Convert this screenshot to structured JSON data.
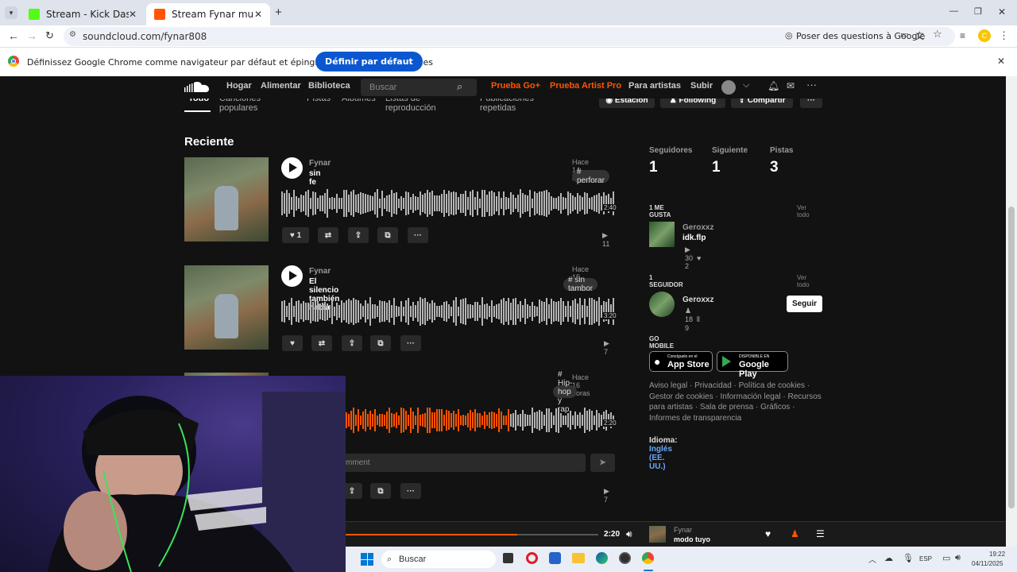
{
  "browser": {
    "tabs": [
      {
        "label": "Stream - Kick Dashboard"
      },
      {
        "label": "Stream Fynar music | Listen to s"
      }
    ],
    "url": "soundcloud.com/fynar808",
    "ask_google": "Poser des questions à Google",
    "infobar_text": "Définissez Google Chrome comme navigateur par défaut et épinglez-le à la barre des tâches",
    "infobar_button": "Définir par défaut"
  },
  "nav": {
    "links": [
      "Hogar",
      "Alimentar",
      "Biblioteca"
    ],
    "search_placeholder": "Buscar",
    "go_plus": "Prueba Go+",
    "artist_pro": "Prueba Artist Pro",
    "for_artists": "Para artistas",
    "upload": "Subir"
  },
  "profile_tabs": [
    "Todo",
    "Canciones populares",
    "Pistas",
    "Álbumes",
    "Listas de reproducción",
    "Publicaciones repetidas"
  ],
  "profile_actions": {
    "station": "Estación",
    "following": "Following",
    "share": "Compartir"
  },
  "section_title": "Reciente",
  "tracks": [
    {
      "artist": "Fynar",
      "title": "sin fe",
      "time": "Hace 14 horas",
      "tag": "# perforar",
      "likes": "1",
      "duration": "2:40",
      "plays": "11"
    },
    {
      "artist": "Fynar",
      "title": "El silencio también habla",
      "time": "Hace 15 horas",
      "tag": "# sin tambor",
      "likes": "",
      "duration": "3:20",
      "plays": "7"
    },
    {
      "artist": "Fynar",
      "title": "",
      "time": "Hace 16 horas",
      "tag": "# Hip-hop y rap",
      "likes": "",
      "duration": "2:20",
      "plays": "7",
      "comment_placeholder": "mment",
      "progress": 0.68
    }
  ],
  "stats": [
    {
      "label": "Seguidores",
      "value": "1"
    },
    {
      "label": "Siguiente",
      "value": "1"
    },
    {
      "label": "Pistas",
      "value": "3"
    }
  ],
  "likes_section": {
    "heading": "1 ME GUSTA",
    "view_all": "Ver todo",
    "artist": "Geroxxz",
    "title": "idk.flp",
    "plays": "30",
    "likes": "2"
  },
  "followers_section": {
    "heading": "1 SEGUIDOR",
    "view_all": "Ver todo",
    "name": "Geroxxz",
    "followers": "18",
    "tracks": "9",
    "follow_button": "Seguir"
  },
  "go_mobile": {
    "heading": "GO MOBILE",
    "app_store_small": "Consíguelo en el",
    "app_store": "App Store",
    "google_play_small": "DISPONIBLE EN",
    "google_play": "Google Play"
  },
  "footer_links": "Aviso legal · Privacidad · Política de cookies · Gestor de cookies · Información legal · Recursos para artistas · Sala de prensa · Gráficos · Informes de transparencia",
  "language": {
    "label": "Idioma:",
    "value": "Inglés (EE. UU.)"
  },
  "player": {
    "elapsed": "2:20",
    "artist": "Fynar",
    "title": "modo tuyo",
    "progress": 0.68
  },
  "taskbar": {
    "search": "Buscar",
    "lang": "ESP",
    "time": "19:22",
    "date": "04/11/2025"
  },
  "colors": {
    "accent": "#ff5500",
    "button_blue": "#0b57d0",
    "sc_bg": "#121212"
  }
}
